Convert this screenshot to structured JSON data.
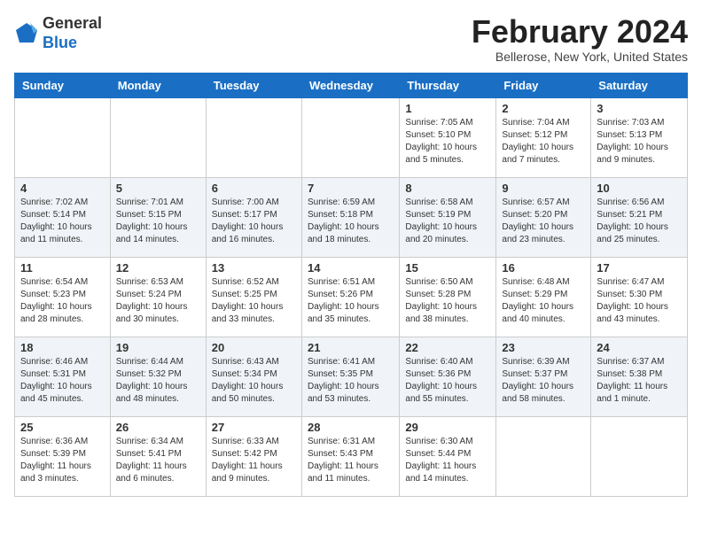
{
  "header": {
    "logo_line1": "General",
    "logo_line2": "Blue",
    "month_title": "February 2024",
    "subtitle": "Bellerose, New York, United States"
  },
  "days_of_week": [
    "Sunday",
    "Monday",
    "Tuesday",
    "Wednesday",
    "Thursday",
    "Friday",
    "Saturday"
  ],
  "weeks": [
    [
      {
        "day": "",
        "info": ""
      },
      {
        "day": "",
        "info": ""
      },
      {
        "day": "",
        "info": ""
      },
      {
        "day": "",
        "info": ""
      },
      {
        "day": "1",
        "info": "Sunrise: 7:05 AM\nSunset: 5:10 PM\nDaylight: 10 hours\nand 5 minutes."
      },
      {
        "day": "2",
        "info": "Sunrise: 7:04 AM\nSunset: 5:12 PM\nDaylight: 10 hours\nand 7 minutes."
      },
      {
        "day": "3",
        "info": "Sunrise: 7:03 AM\nSunset: 5:13 PM\nDaylight: 10 hours\nand 9 minutes."
      }
    ],
    [
      {
        "day": "4",
        "info": "Sunrise: 7:02 AM\nSunset: 5:14 PM\nDaylight: 10 hours\nand 11 minutes."
      },
      {
        "day": "5",
        "info": "Sunrise: 7:01 AM\nSunset: 5:15 PM\nDaylight: 10 hours\nand 14 minutes."
      },
      {
        "day": "6",
        "info": "Sunrise: 7:00 AM\nSunset: 5:17 PM\nDaylight: 10 hours\nand 16 minutes."
      },
      {
        "day": "7",
        "info": "Sunrise: 6:59 AM\nSunset: 5:18 PM\nDaylight: 10 hours\nand 18 minutes."
      },
      {
        "day": "8",
        "info": "Sunrise: 6:58 AM\nSunset: 5:19 PM\nDaylight: 10 hours\nand 20 minutes."
      },
      {
        "day": "9",
        "info": "Sunrise: 6:57 AM\nSunset: 5:20 PM\nDaylight: 10 hours\nand 23 minutes."
      },
      {
        "day": "10",
        "info": "Sunrise: 6:56 AM\nSunset: 5:21 PM\nDaylight: 10 hours\nand 25 minutes."
      }
    ],
    [
      {
        "day": "11",
        "info": "Sunrise: 6:54 AM\nSunset: 5:23 PM\nDaylight: 10 hours\nand 28 minutes."
      },
      {
        "day": "12",
        "info": "Sunrise: 6:53 AM\nSunset: 5:24 PM\nDaylight: 10 hours\nand 30 minutes."
      },
      {
        "day": "13",
        "info": "Sunrise: 6:52 AM\nSunset: 5:25 PM\nDaylight: 10 hours\nand 33 minutes."
      },
      {
        "day": "14",
        "info": "Sunrise: 6:51 AM\nSunset: 5:26 PM\nDaylight: 10 hours\nand 35 minutes."
      },
      {
        "day": "15",
        "info": "Sunrise: 6:50 AM\nSunset: 5:28 PM\nDaylight: 10 hours\nand 38 minutes."
      },
      {
        "day": "16",
        "info": "Sunrise: 6:48 AM\nSunset: 5:29 PM\nDaylight: 10 hours\nand 40 minutes."
      },
      {
        "day": "17",
        "info": "Sunrise: 6:47 AM\nSunset: 5:30 PM\nDaylight: 10 hours\nand 43 minutes."
      }
    ],
    [
      {
        "day": "18",
        "info": "Sunrise: 6:46 AM\nSunset: 5:31 PM\nDaylight: 10 hours\nand 45 minutes."
      },
      {
        "day": "19",
        "info": "Sunrise: 6:44 AM\nSunset: 5:32 PM\nDaylight: 10 hours\nand 48 minutes."
      },
      {
        "day": "20",
        "info": "Sunrise: 6:43 AM\nSunset: 5:34 PM\nDaylight: 10 hours\nand 50 minutes."
      },
      {
        "day": "21",
        "info": "Sunrise: 6:41 AM\nSunset: 5:35 PM\nDaylight: 10 hours\nand 53 minutes."
      },
      {
        "day": "22",
        "info": "Sunrise: 6:40 AM\nSunset: 5:36 PM\nDaylight: 10 hours\nand 55 minutes."
      },
      {
        "day": "23",
        "info": "Sunrise: 6:39 AM\nSunset: 5:37 PM\nDaylight: 10 hours\nand 58 minutes."
      },
      {
        "day": "24",
        "info": "Sunrise: 6:37 AM\nSunset: 5:38 PM\nDaylight: 11 hours\nand 1 minute."
      }
    ],
    [
      {
        "day": "25",
        "info": "Sunrise: 6:36 AM\nSunset: 5:39 PM\nDaylight: 11 hours\nand 3 minutes."
      },
      {
        "day": "26",
        "info": "Sunrise: 6:34 AM\nSunset: 5:41 PM\nDaylight: 11 hours\nand 6 minutes."
      },
      {
        "day": "27",
        "info": "Sunrise: 6:33 AM\nSunset: 5:42 PM\nDaylight: 11 hours\nand 9 minutes."
      },
      {
        "day": "28",
        "info": "Sunrise: 6:31 AM\nSunset: 5:43 PM\nDaylight: 11 hours\nand 11 minutes."
      },
      {
        "day": "29",
        "info": "Sunrise: 6:30 AM\nSunset: 5:44 PM\nDaylight: 11 hours\nand 14 minutes."
      },
      {
        "day": "",
        "info": ""
      },
      {
        "day": "",
        "info": ""
      }
    ]
  ]
}
